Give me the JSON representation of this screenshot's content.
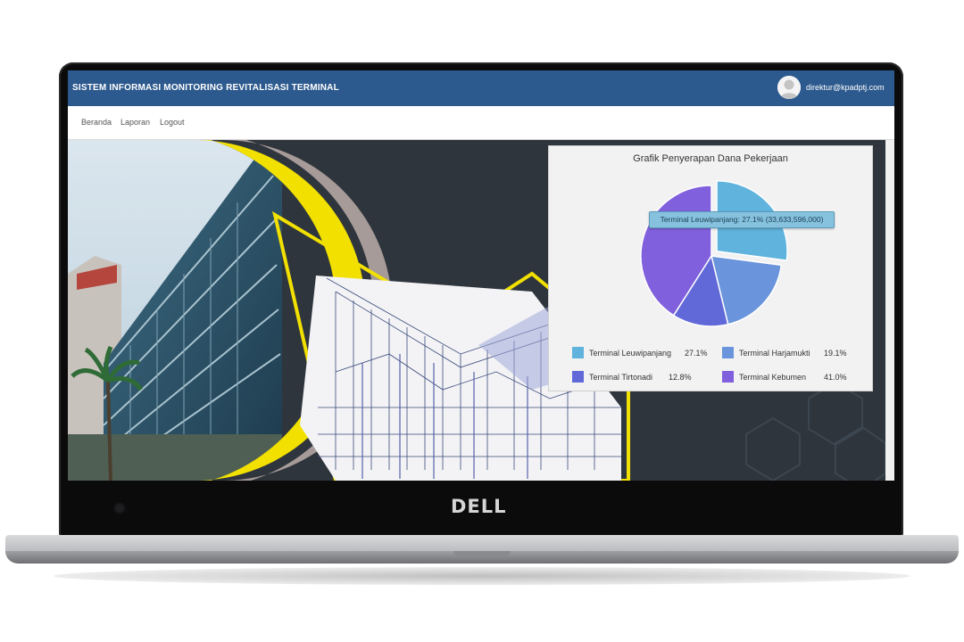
{
  "app": {
    "title": "SISTEM INFORMASI MONITORING REVITALISASI TERMINAL",
    "user_email": "direktur@kpadptj.com"
  },
  "nav": {
    "items": [
      {
        "label": "Beranda"
      },
      {
        "label": "Laporan"
      },
      {
        "label": "Logout"
      }
    ]
  },
  "device": {
    "brand": "DELL"
  },
  "colors": {
    "header": "#2d5a8e",
    "accent_yellow": "#f1e000",
    "banner_dark": "#2f353d"
  },
  "chart": {
    "title": "Grafik Penyerapan Dana Pekerjaan",
    "tooltip": "Terminal Leuwipanjang: 27.1% (33,633,596,000)"
  },
  "chart_data": {
    "type": "pie",
    "title": "Grafik Penyerapan Dana Pekerjaan",
    "series": [
      {
        "name": "Terminal Leuwipanjang",
        "value": 27.1,
        "value_label": "27.1%",
        "color": "#5fb3dd"
      },
      {
        "name": "Terminal Harjamukti",
        "value": 19.1,
        "value_label": "19.1%",
        "color": "#6a94dc"
      },
      {
        "name": "Terminal Tirtonadi",
        "value": 12.8,
        "value_label": "12.8%",
        "color": "#6168d8"
      },
      {
        "name": "Terminal Kebumen",
        "value": 41.0,
        "value_label": "41.0%",
        "color": "#8060dc"
      }
    ],
    "highlighted": "Terminal Leuwipanjang",
    "legend_position": "bottom"
  }
}
